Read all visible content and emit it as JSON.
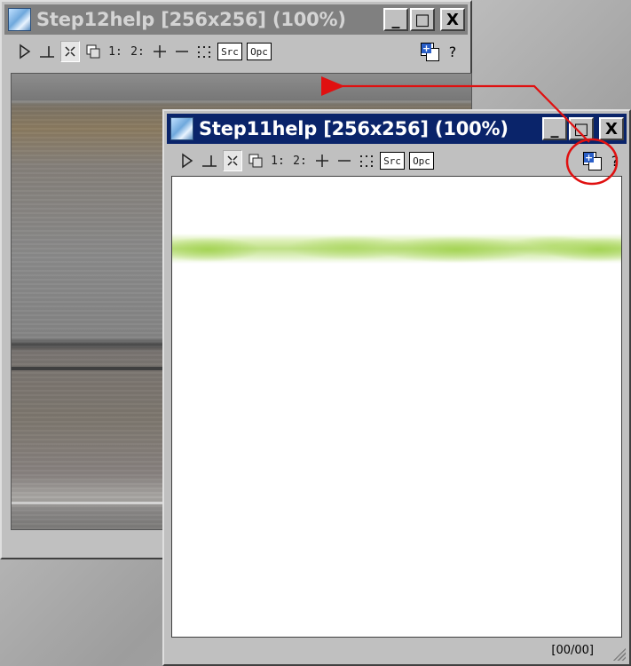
{
  "back_window": {
    "title": "Step12help [256x256] (100%)",
    "minimize": "_",
    "maximize": "□",
    "close": "X",
    "toolbar": {
      "one": "1:",
      "two": "2:",
      "src": "Src",
      "opc": "Opc",
      "help": "?"
    }
  },
  "front_window": {
    "title": "Step11help [256x256] (100%)",
    "minimize": "_",
    "maximize": "□",
    "close": "X",
    "toolbar": {
      "one": "1:",
      "two": "2:",
      "src": "Src",
      "opc": "Opc",
      "help": "?"
    },
    "status": "[00/00]"
  },
  "icons": [
    "app-icon",
    "play-icon",
    "anchor-icon",
    "select-icon",
    "copy-icon",
    "plus-icon",
    "minus-icon",
    "dots-icon",
    "copy-paste-icon",
    "help-icon",
    "resize-grip-icon"
  ],
  "colors": {
    "active_title": "#0a246a",
    "inactive_title": "#808080",
    "annotation": "#e01010",
    "green_band": "#a3d352"
  }
}
